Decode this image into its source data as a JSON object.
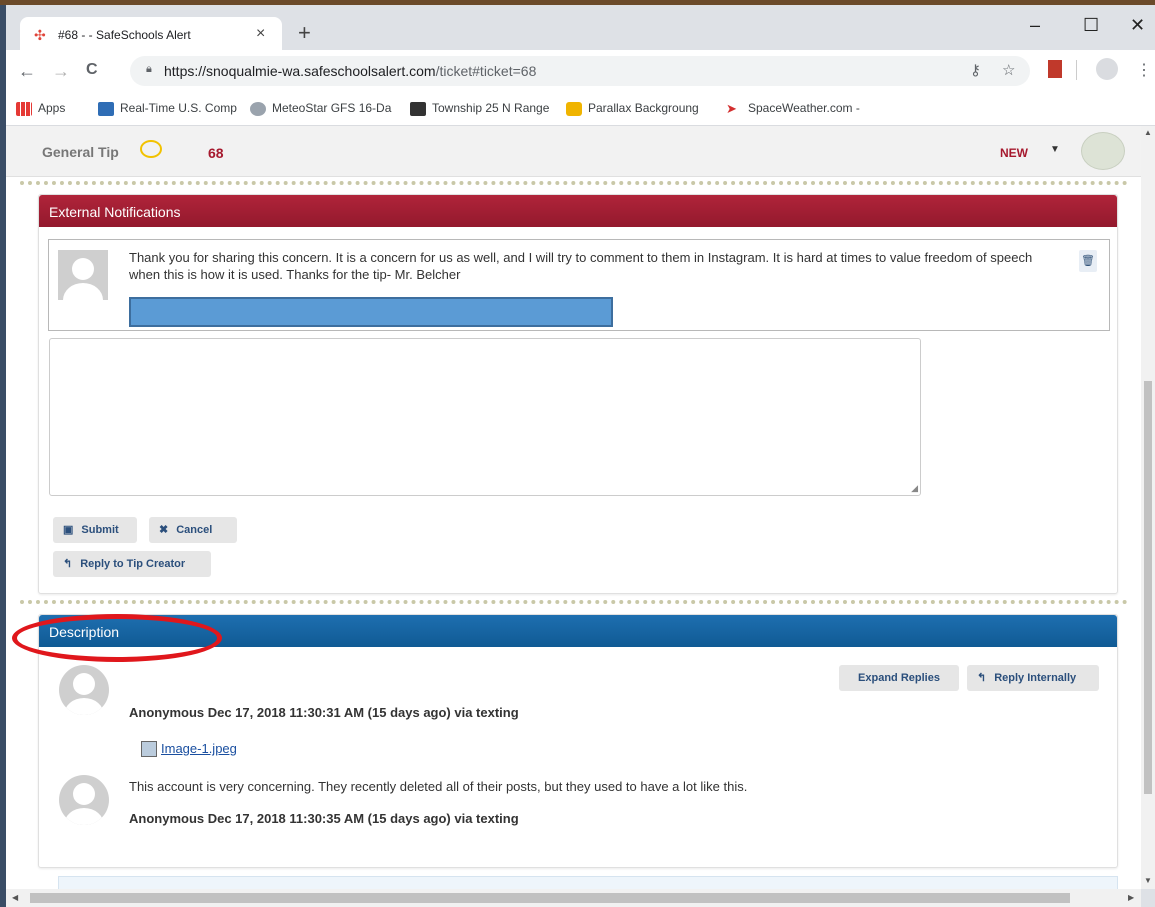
{
  "browser": {
    "tab_title": "#68 - - SafeSchools Alert",
    "tab_close": "×",
    "new_tab": "+",
    "url_host": "https://snoqualmie-wa.safeschoolsalert.com",
    "url_path": "/ticket#ticket=68",
    "window_controls": {
      "minimize": "–",
      "maximize": "☐",
      "close": "✕"
    },
    "nav": {
      "back": "←",
      "forward": "→",
      "reload": "C"
    }
  },
  "bookmarks": [
    {
      "label": "Apps",
      "icon": "apps-grid-icon",
      "color": "#1a73e8"
    },
    {
      "label": "Real-Time U.S. Comp",
      "icon": "map-icon",
      "color": "#2f6db5"
    },
    {
      "label": "MeteoStar GFS 16-Da",
      "icon": "meteostar-icon",
      "color": "#7a7a7a"
    },
    {
      "label": "Township 25 N Range",
      "icon": "township-icon",
      "color": "#333333"
    },
    {
      "label": "Parallax Backgroung",
      "icon": "shield-icon",
      "color": "#f0b400"
    },
    {
      "label": "SpaceWeather.com -",
      "icon": "spaceweather-icon",
      "color": "#d32f2f"
    }
  ],
  "ticket": {
    "category": "General Tip",
    "number": "68",
    "status": "NEW",
    "status_color": "#a6192e"
  },
  "external_notifications": {
    "title": "External Notifications",
    "note_text": "Thank you for sharing this concern. It is a concern for us as well, and I will try to comment to them in Instagram. It is hard at times to value freedom of speech when this is how it is used. Thanks for the tip- Mr. Belcher",
    "reply_value": "",
    "buttons": {
      "submit": "Submit",
      "cancel": "Cancel",
      "reply_creator": "Reply to Tip Creator"
    }
  },
  "description": {
    "title": "Description",
    "buttons": {
      "expand": "Expand Replies",
      "reply_internal": "Reply Internally"
    },
    "entries": [
      {
        "author_line": "Anonymous Dec 17, 2018 11:30:31 AM (15 days ago) via texting",
        "attachment": "Image-1.jpeg"
      },
      {
        "text": "This account is very concerning. They recently deleted all of their posts, but they used to have a lot like this.",
        "author_line": "Anonymous Dec 17, 2018 11:30:35 AM (15 days ago) via texting"
      }
    ]
  },
  "colors": {
    "red_header": "#a6192e",
    "blue_header": "#1a66a8",
    "annotation": "#e0171c"
  }
}
